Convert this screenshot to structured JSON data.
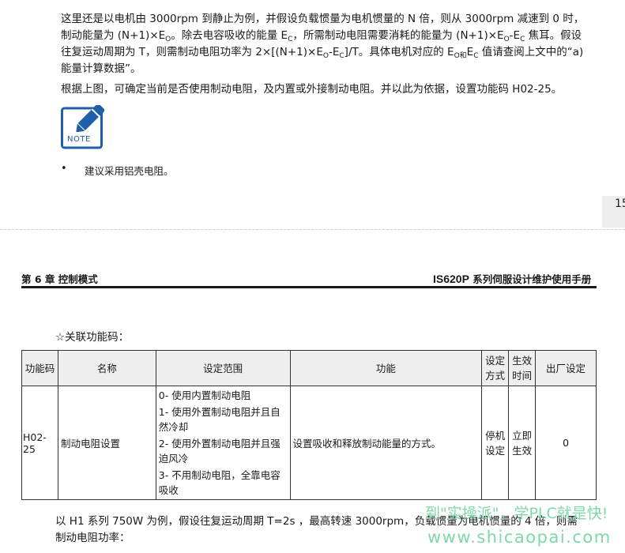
{
  "top_paragraph": {
    "line1": "这里还是以电机由 3000rpm 到静止为例，并假设负载惯量为电机惯量的 N 倍，则从 3000rpm 减速到 0 时，",
    "line2_a": "制动能量为 (N+1)×E",
    "line2_sub1": "O",
    "line2_b": "。除去电容吸收的能量 E",
    "line2_sub2": "C",
    "line2_c": "，所需制动电阻需要消耗的能量为 (N+1)×E",
    "line2_sub3": "O",
    "line2_d": "-E",
    "line2_sub4": "C",
    "line2_e": " 焦耳。假设",
    "line3_a": "往复运动周期为 T，则需制动电阻功率为 2×[(N+1)×E",
    "line3_sub1": "O",
    "line3_b": "-E",
    "line3_sub2": "C",
    "line3_c": "]/T。具体电机对应的 E",
    "line3_sub3": "O和",
    "line3_d": "E",
    "line3_sub4": "C",
    "line3_e": " 值请查阅上文中的“a)",
    "line4": "能量计算数据”。"
  },
  "paragraph2": "根据上图，可确定当前是否使用制动电阻，及内置或外接制动电阻。并以此为依据，设置功能码 H02-25。",
  "note": {
    "label": "NOTE",
    "icon": "pencil-note-icon",
    "color": "#1d5fa8"
  },
  "bullet": {
    "marker": "•",
    "text": "建议采用铝壳电阻。"
  },
  "page_number": "15",
  "header": {
    "left": "第 6 章  控制模式",
    "right_bold": "IS620P",
    "right_rest": " 系列伺服设计维护使用手册"
  },
  "related_title": "☆关联功能码：",
  "table": {
    "headers": {
      "code": "功能码",
      "name": "名称",
      "range": "设定范围",
      "function": "功能",
      "setting_line1": "设定",
      "setting_line2": "方式",
      "effective_line1": "生效",
      "effective_line2": "时间",
      "default": "出厂设定"
    },
    "row": {
      "code": "H02-25",
      "name": "制动电阻设置",
      "range": [
        "0- 使用内置制动电阻",
        "1- 使用外置制动电阻并且自然冷却",
        "2- 使用外置制动电阻并且强迫风冷",
        "3- 不用制动电阻，全靠电容吸收"
      ],
      "function": "设置吸收和释放制动能量的方式。",
      "setting_line1": "停机",
      "setting_line2": "设定",
      "effective_line1": "立即",
      "effective_line2": "生效",
      "default": "0"
    }
  },
  "bottom_paragraph": {
    "line1": "以 H1 系列 750W 为例，假设往复运动周期 T=2s ，最高转速 3000rpm，负载惯量为电机惯量的 4 倍，则需",
    "line2": "制动电阻功率："
  },
  "watermark": {
    "line1": "到\"实操派\"，学PLC就是快!",
    "line2": "www.shicaopai.com",
    "color": "#7fd8a8"
  }
}
